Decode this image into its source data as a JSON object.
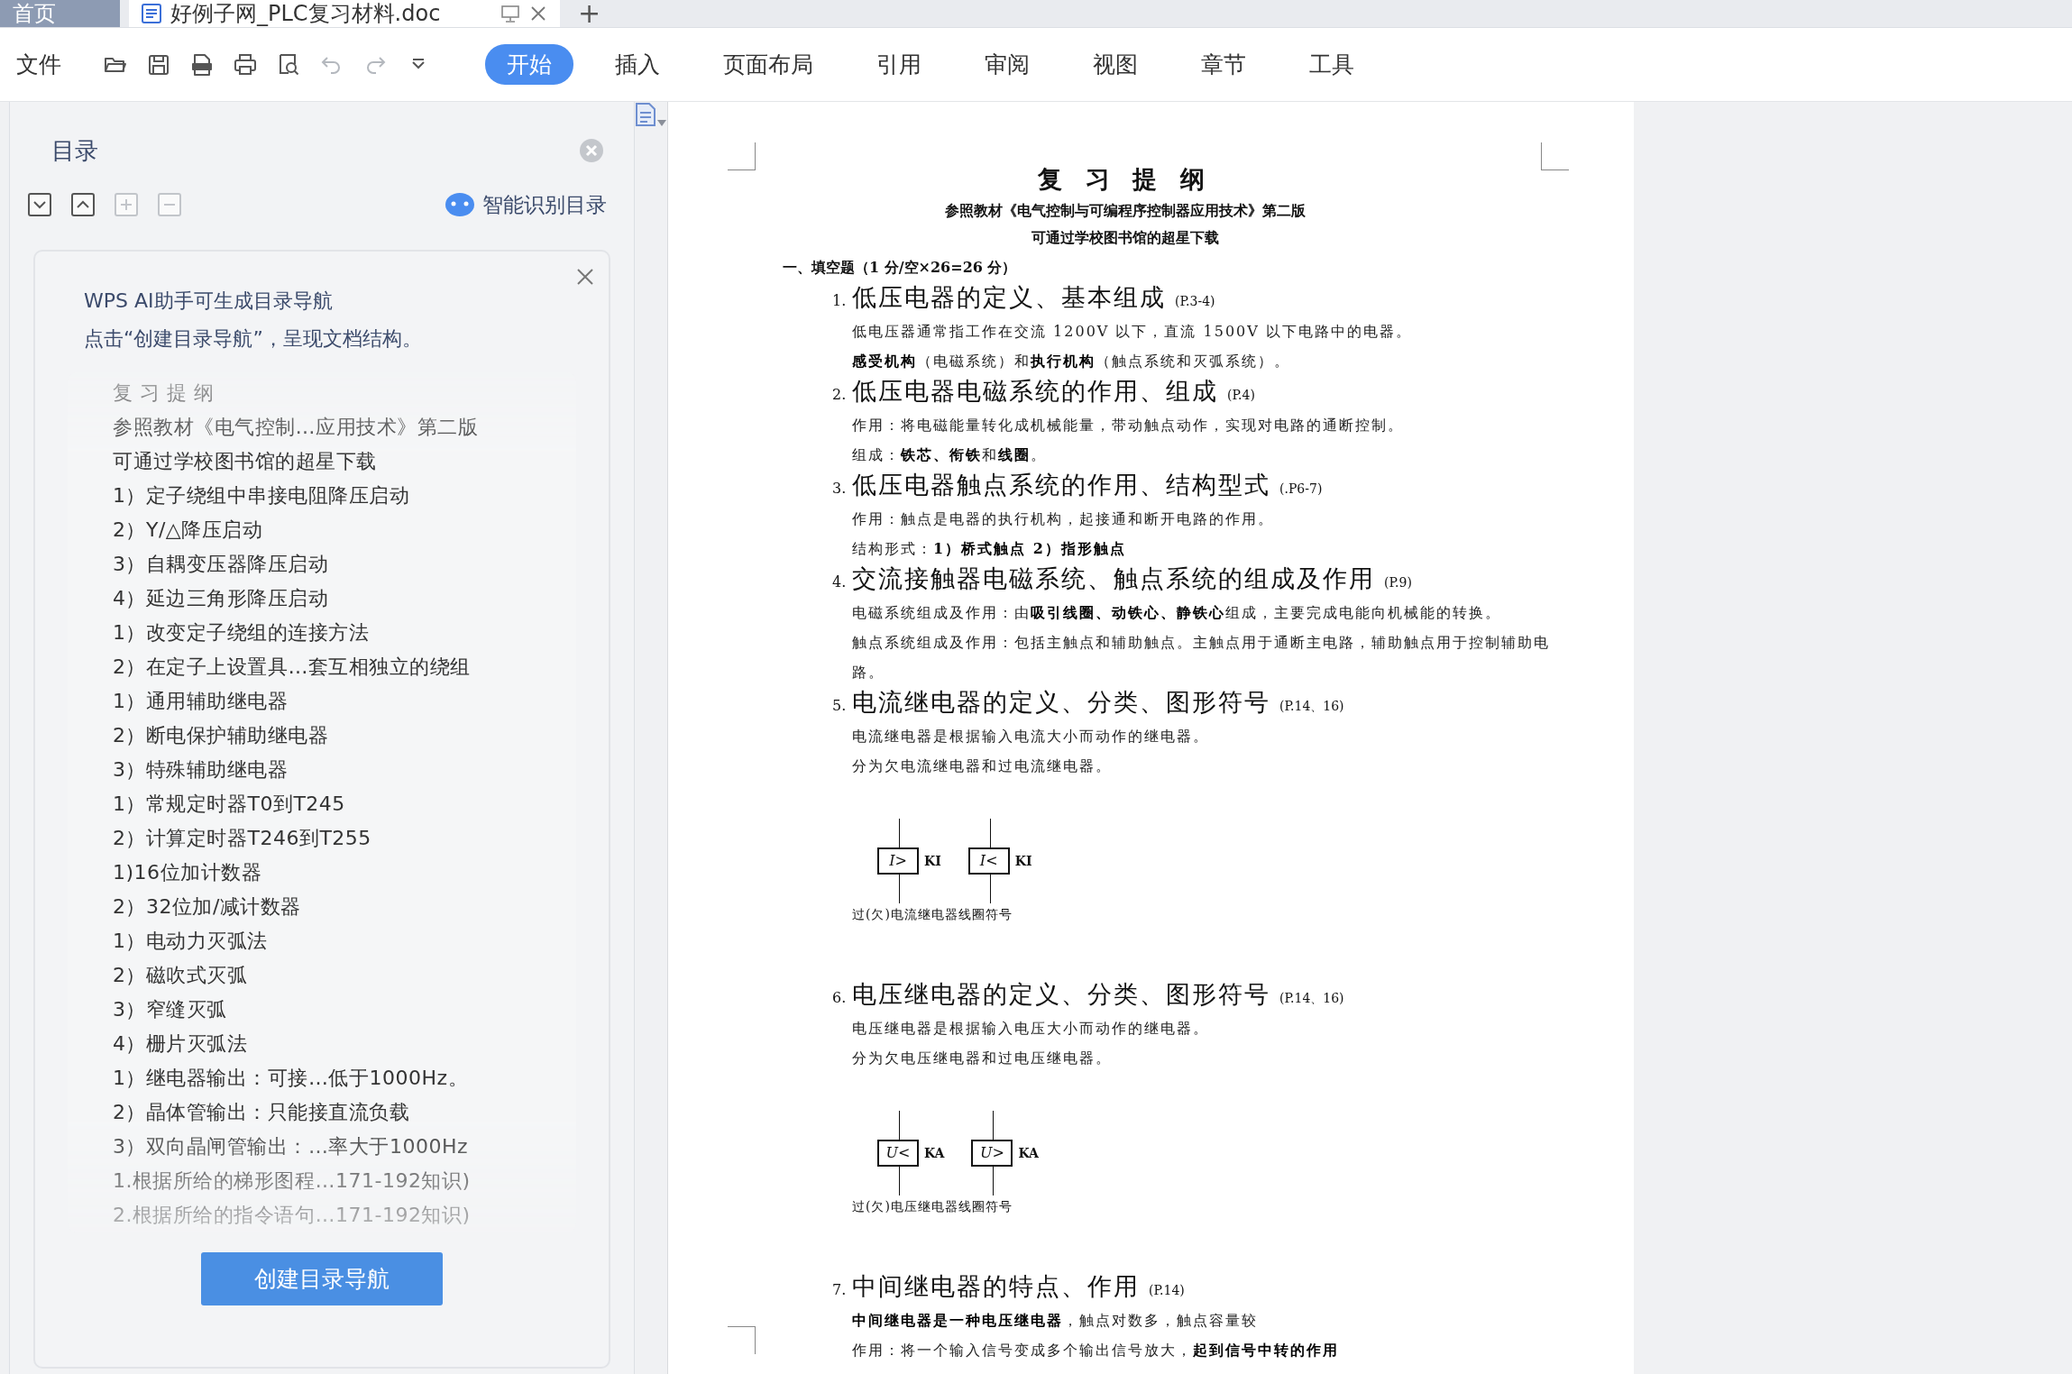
{
  "window_tabs": [
    {
      "kind": "home",
      "label": "首页",
      "selected": false
    },
    {
      "kind": "document",
      "label": "好例子网_PLC复习材料.doc",
      "selected": true
    }
  ],
  "new_tab": "+",
  "ribbon": {
    "file_menu": "文件",
    "quick_tools": [
      {
        "kind": "open",
        "disabled": false
      },
      {
        "kind": "save",
        "disabled": false
      },
      {
        "kind": "pdf",
        "disabled": false
      },
      {
        "kind": "print",
        "disabled": false
      },
      {
        "kind": "preview",
        "disabled": false
      },
      {
        "kind": "undo",
        "disabled": true
      },
      {
        "kind": "redo",
        "disabled": true
      },
      {
        "kind": "more",
        "disabled": false
      }
    ],
    "tabs": [
      {
        "label": "开始",
        "selected": true
      },
      {
        "label": "插入",
        "selected": false
      },
      {
        "label": "页面布局",
        "selected": false
      },
      {
        "label": "引用",
        "selected": false
      },
      {
        "label": "审阅",
        "selected": false
      },
      {
        "label": "视图",
        "selected": false
      },
      {
        "label": "章节",
        "selected": false
      },
      {
        "label": "工具",
        "selected": false
      }
    ]
  },
  "toc_panel": {
    "title": "目录",
    "tools": [
      {
        "kind": "expand",
        "disabled": false
      },
      {
        "kind": "collapse",
        "disabled": false
      },
      {
        "kind": "add",
        "disabled": true
      },
      {
        "kind": "remove",
        "disabled": true
      }
    ],
    "smart_detect": "智能识别目录",
    "ai_card": {
      "lines": [
        "WPS AI助手可生成目录导航",
        "点击“创建目录导航”，呈现文档结构。"
      ],
      "preview_items": [
        "复 习 提 纲",
        "参照教材《电气控制…应用技术》第二版",
        "可通过学校图书馆的超星下载",
        "1）定子绕组中串接电阻降压启动",
        "2）Y/△降压启动",
        "3）自耦变压器降压启动",
        "4）延边三角形降压启动",
        "1）改变定子绕组的连接方法",
        "2）在定子上设置具…套互相独立的绕组",
        "1）通用辅助继电器",
        "2）断电保护辅助继电器",
        "3）特殊辅助继电器",
        "1）常规定时器T0到T245",
        "2）计算定时器T246到T255",
        "1)16位加计数器",
        "2）32位加/减计数器",
        "1）电动力灭弧法",
        "2）磁吹式灭弧",
        "3）窄缝灭弧",
        "4）栅片灭弧法",
        "1）继电器输出：可接…低于1000Hz。",
        "2）晶体管输出：只能接直流负载",
        "3）双向晶闸管输出：…率大于1000Hz",
        "1.根据所给的梯形图程…171-192知识)",
        "2.根据所给的指令语句…171-192知识)"
      ],
      "button": "创建目录导航"
    }
  },
  "document": {
    "title": "复 习 提 纲",
    "subtitles": [
      "参照教材《电气控制与可编程序控制器应用技术》第二版",
      "可通过学校图书馆的超星下载"
    ],
    "section": "一、填空题（1 分/空×26=26 分）",
    "items": [
      {
        "number": "1.",
        "heading": "低压电器的定义、基本组成",
        "ref": "(P.3-4)",
        "lines": [
          "低电压器通常指工作在交流 1200V 以下，直流 1500V 以下电路中的电器。",
          "**感受机构**（电磁系统）和**执行机构**（触点系统和灭弧系统）。"
        ]
      },
      {
        "number": "2.",
        "heading": "低压电器电磁系统的作用、组成",
        "ref": "(P.4)",
        "lines": [
          "作用：将电磁能量转化成机械能量，带动触点动作，实现对电路的通断控制。",
          "组成：**铁芯、衔铁**和**线圈**。"
        ]
      },
      {
        "number": "3.",
        "heading": "低压电器触点系统的作用、结构型式",
        "ref": "(.P6-7)",
        "lines": [
          "作用：触点是电器的执行机构，起接通和断开电路的作用。",
          "结构形式：**1）桥式触点 2）指形触点**"
        ]
      },
      {
        "number": "4.",
        "heading": "交流接触器电磁系统、触点系统的组成及作用",
        "ref": "(P.9)",
        "lines": [
          "电磁系统组成及作用：由**吸引线圈、动铁心、静铁心**组成，主要完成电能向机械能的转换。",
          "触点系统组成及作用：包括主触点和辅助触点。主触点用于通断主电路，辅助触点用于控制辅助电路。"
        ]
      },
      {
        "number": "5.",
        "heading": "电流继电器的定义、分类、图形符号",
        "ref": "(P.14、16)",
        "lines": [
          "电流继电器是根据输入电流大小而动作的继电器。",
          "分为欠电流继电器和过电流继电器。"
        ],
        "figure": {
          "symbols": [
            {
              "symbol": "I>",
              "code": "KI"
            },
            {
              "symbol": "I<",
              "code": "KI"
            }
          ],
          "caption": "过(欠)电流继电器线圈符号"
        }
      },
      {
        "number": "6.",
        "heading": "电压继电器的定义、分类、图形符号",
        "ref": "(P.14、16)",
        "lines": [
          "电压继电器是根据输入电压大小而动作的继电器。",
          "分为欠电压继电器和过电压继电器。"
        ],
        "figure": {
          "symbols": [
            {
              "symbol": "U<",
              "code": "KA"
            },
            {
              "symbol": "U>",
              "code": "KA"
            }
          ],
          "caption": "过(欠)电压继电器线圈符号"
        }
      },
      {
        "number": "7.",
        "heading": "中间继电器的特点、作用",
        "ref": "(P.14)",
        "lines": [
          "**中间继电器是一种电压继电器**，触点对数多，触点容量较",
          "作用：将一个输入信号变成多个输出信号放大，**起到信号中转的作用**"
        ]
      }
    ]
  }
}
